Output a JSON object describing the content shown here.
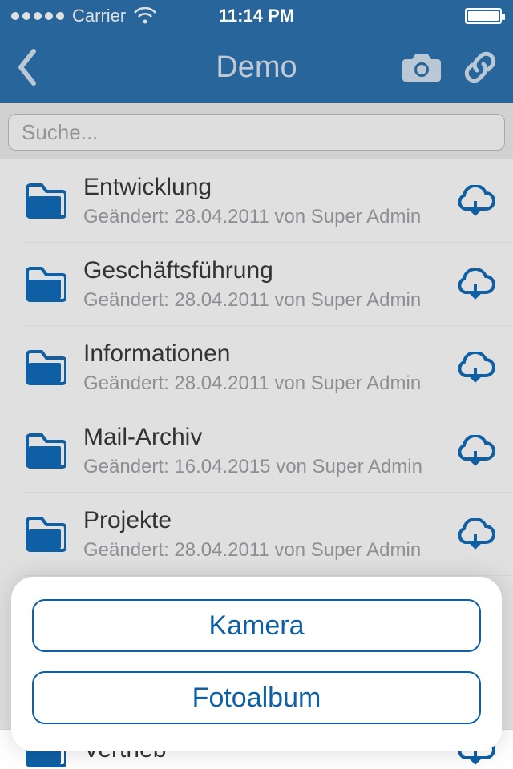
{
  "status": {
    "carrier": "Carrier",
    "time": "11:14 PM"
  },
  "nav": {
    "title": "Demo"
  },
  "search": {
    "placeholder": "Suche..."
  },
  "folders": [
    {
      "name": "Entwicklung",
      "meta": "Geändert: 28.04.2011 von Super Admin"
    },
    {
      "name": "Geschäftsführung",
      "meta": "Geändert: 28.04.2011 von Super Admin"
    },
    {
      "name": "Informationen",
      "meta": "Geändert: 28.04.2011 von Super Admin"
    },
    {
      "name": "Mail-Archiv",
      "meta": "Geändert: 16.04.2015 von Super Admin"
    },
    {
      "name": "Projekte",
      "meta": "Geändert: 28.04.2011 von Super Admin"
    }
  ],
  "peek": {
    "name": "Vertrieb"
  },
  "sheet": {
    "camera": "Kamera",
    "album": "Fotoalbum"
  },
  "colors": {
    "brand": "#0f5fa4"
  }
}
